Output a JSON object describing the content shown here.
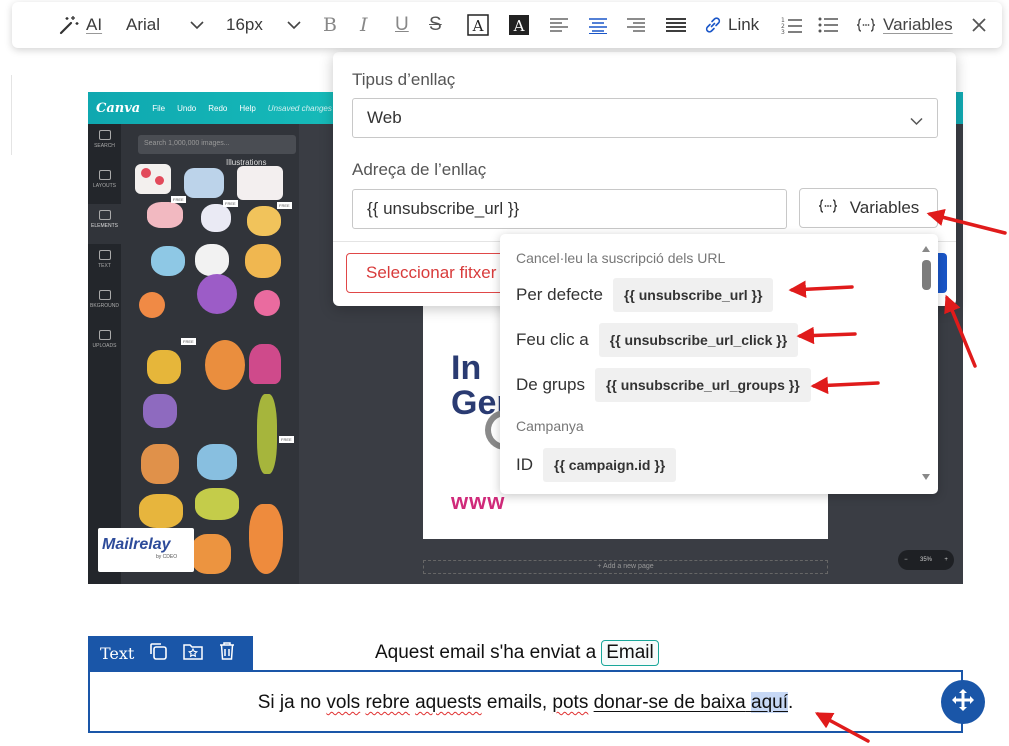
{
  "toolbar": {
    "ai_label": "AI",
    "font_family": "Arial",
    "font_size": "16px",
    "link_label": "Link",
    "variables_label": "Variables"
  },
  "canvas": {
    "menu": [
      "File",
      "Undo",
      "Redo",
      "Help",
      "Unsaved changes"
    ],
    "search_placeholder": "Search 1,000,000 images...",
    "panel_title": "Illustrations",
    "side_items": [
      "SEARCH",
      "LAYOUTS",
      "ELEMENTS",
      "TEXT",
      "BKGROUND",
      "UPLOADS"
    ],
    "page_text": [
      "In ",
      "Gen"
    ],
    "url_prefix": "www",
    "add_page": "+ Add a new page",
    "zoom": "35%",
    "free_badge": "FREE",
    "logo_text": "Canva",
    "mailrelay_logo": "Mailrelay",
    "mailrelay_sub": "by CDEO"
  },
  "link_popup": {
    "type_label": "Tipus d’enllaç",
    "type_value": "Web",
    "address_label": "Adreça de l’enllaç",
    "address_value": "{{ unsubscribe_url }}",
    "variables_button": "Variables",
    "select_file_button": "Seleccionar fitxer"
  },
  "variables_dropdown": {
    "groups": [
      {
        "header": "Cancel·leu la suscripció dels URL",
        "items": [
          {
            "label": "Per defecte",
            "value": "{{ unsubscribe_url }}"
          },
          {
            "label": "Feu clic a",
            "value": "{{ unsubscribe_url_click }}"
          },
          {
            "label": "De grups",
            "value": "{{ unsubscribe_url_groups }}"
          }
        ]
      },
      {
        "header": "Campanya",
        "items": [
          {
            "label": "ID",
            "value": "{{ campaign.id }}"
          }
        ]
      }
    ]
  },
  "editor": {
    "email_line_prefix": "Aquest email s'ha enviat a",
    "email_chip": "Email",
    "block_tag": "Text",
    "body": {
      "part1": "Si ja no ",
      "w_vols": "vols",
      "part2": " ",
      "w_rebre": "rebre",
      "part3": " ",
      "w_aquests": "aquests",
      "part4": " emails, ",
      "w_pots": "pots",
      "part5": " ",
      "w_donar": "donar-se de baixa",
      "part6": " ",
      "w_aqui": "aquí",
      "part7": "."
    }
  },
  "colors": {
    "accent": "#1a56c8",
    "block_blue": "#1a56a8",
    "danger": "#d83b3b",
    "arrow": "#e01b1b"
  }
}
